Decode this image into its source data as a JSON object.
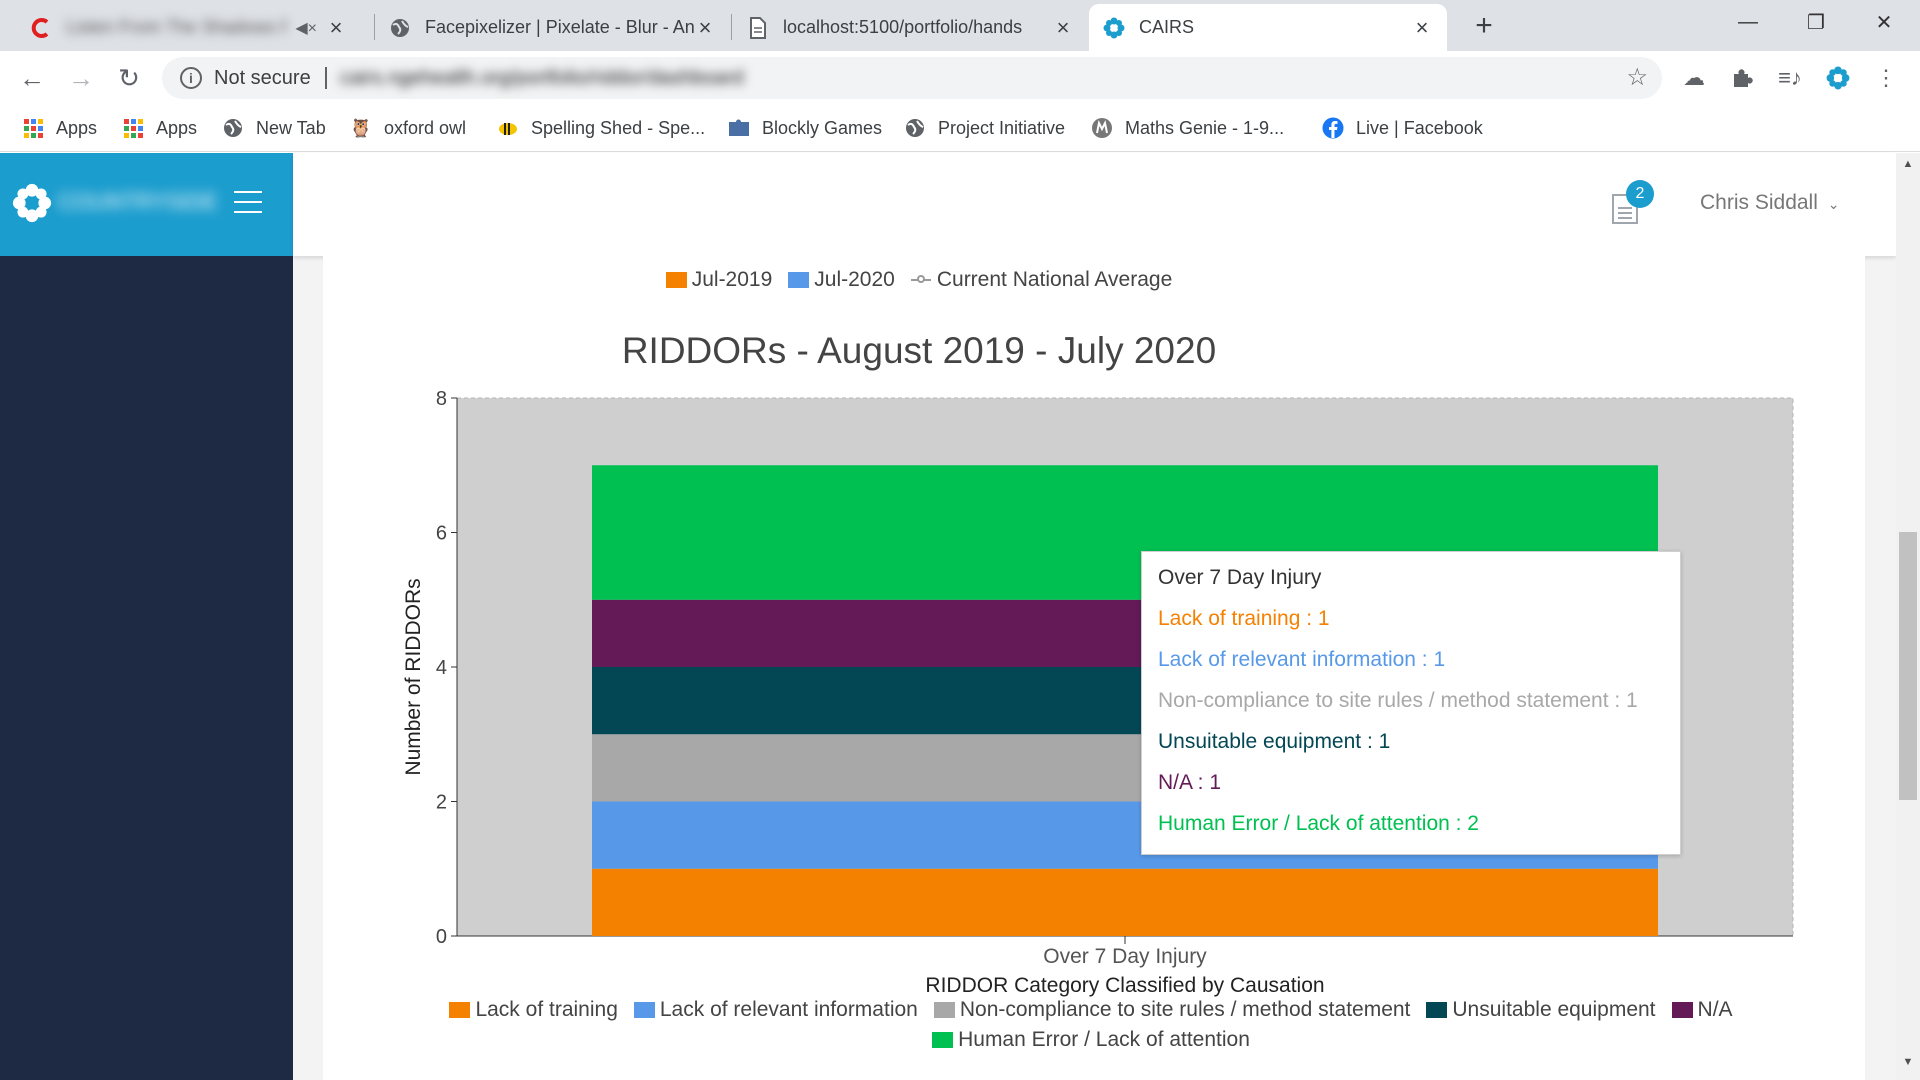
{
  "browser": {
    "tabs": [
      {
        "title": "Listen From The Shadows Pt",
        "blurred": true
      },
      {
        "title": "Facepixelizer | Pixelate - Blur - An"
      },
      {
        "title": "localhost:5100/portfolio/hands"
      },
      {
        "title": "CAIRS",
        "active": true
      }
    ],
    "address": {
      "security_label": "Not secure",
      "url": "cairs.ngehealth.org/portfolio/riddor/dashboard"
    },
    "bookmarks": [
      {
        "label": "Apps",
        "icon": "apps-grid-icon"
      },
      {
        "label": "Apps",
        "icon": "apps-grid-icon"
      },
      {
        "label": "New Tab",
        "icon": "globe-icon"
      },
      {
        "label": "oxford owl",
        "icon": "owl-icon"
      },
      {
        "label": "Spelling Shed - Spe...",
        "icon": "bee-icon"
      },
      {
        "label": "Blockly Games",
        "icon": "puzzle-icon"
      },
      {
        "label": "Project Initiative",
        "icon": "globe-icon"
      },
      {
        "label": "Maths Genie - 1-9...",
        "icon": "maths-genie-icon"
      },
      {
        "label": "Live | Facebook",
        "icon": "facebook-icon"
      }
    ]
  },
  "app": {
    "brand": "COUNTRYSIDE",
    "notification_count": "2",
    "user_name": "Chris Siddall"
  },
  "colors": {
    "accent": "#1b9dce",
    "sidebar": "#1e2a44",
    "lack_of_training": "#f58100",
    "lack_of_relevant_information": "#5799e8",
    "non_compliance": "#a8a8a8",
    "unsuitable_equipment": "#044754",
    "na": "#631a56",
    "human_error": "#00c052"
  },
  "chart_data": {
    "type": "bar",
    "stacked": true,
    "title": "RIDDORs - August 2019 - July 2020",
    "xlabel": "RIDDOR Category Classified by Causation",
    "ylabel": "Number of RIDDORs",
    "ylim": [
      0,
      8
    ],
    "yticks": [
      0,
      2,
      4,
      6,
      8
    ],
    "categories": [
      "Over 7 Day Injury"
    ],
    "series": [
      {
        "name": "Lack of training",
        "values": [
          1
        ],
        "color": "#f58100"
      },
      {
        "name": "Lack of relevant information",
        "values": [
          1
        ],
        "color": "#5799e8"
      },
      {
        "name": "Non-compliance to site rules / method statement",
        "values": [
          1
        ],
        "color": "#a8a8a8"
      },
      {
        "name": "Unsuitable equipment",
        "values": [
          1
        ],
        "color": "#044754"
      },
      {
        "name": "N/A",
        "values": [
          1
        ],
        "color": "#631a56"
      },
      {
        "name": "Human Error / Lack of attention",
        "values": [
          2
        ],
        "color": "#00c052"
      }
    ],
    "top_legend": [
      {
        "name": "Jul-2019",
        "kind": "box",
        "color": "#f58100"
      },
      {
        "name": "Jul-2020",
        "kind": "box",
        "color": "#5799e8"
      },
      {
        "name": "Current National Average",
        "kind": "line",
        "color": "#999999"
      }
    ],
    "tooltip": {
      "title": "Over 7 Day Injury",
      "lines": [
        "Lack of training : 1",
        "Lack of relevant information : 1",
        "Non-compliance to site rules / method statement : 1",
        "Unsuitable equipment : 1",
        "N/A : 1",
        "Human Error / Lack of attention : 2"
      ]
    },
    "grid": false,
    "legend_position": "bottom"
  }
}
